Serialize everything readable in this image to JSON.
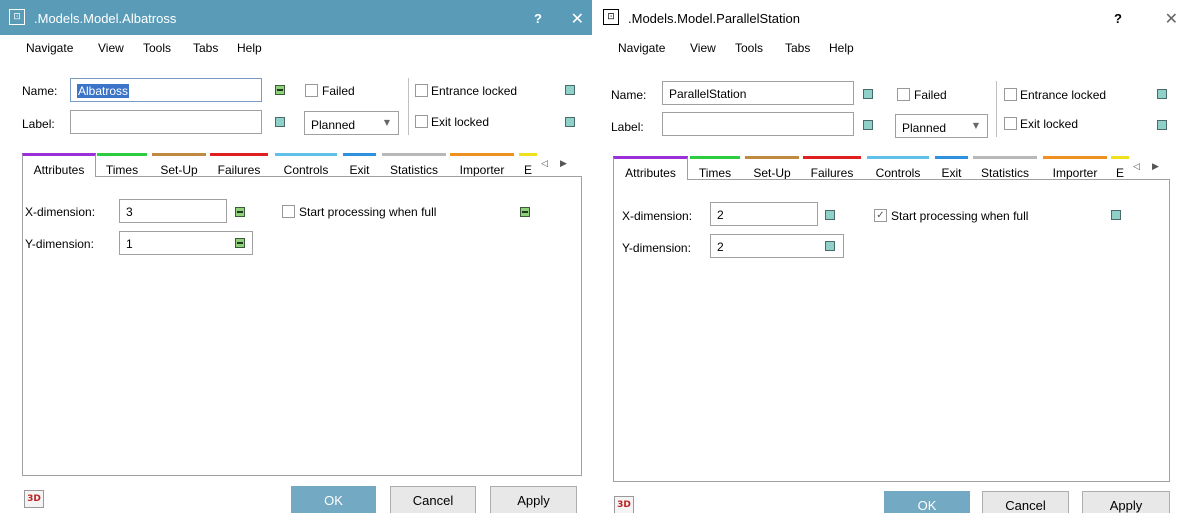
{
  "dialogs": [
    {
      "title": ".Models.Model.Albatross",
      "help": "?",
      "close": "✕",
      "menu": [
        "Navigate",
        "View",
        "Tools",
        "Tabs",
        "Help"
      ],
      "name_label": "Name:",
      "name_value": "Albatross",
      "label_label": "Label:",
      "label_value": "",
      "failed_label": "Failed",
      "failed_checked": false,
      "status_value": "Planned",
      "entrance_locked_label": "Entrance locked",
      "exit_locked_label": "Exit locked",
      "tabs": [
        "Attributes",
        "Times",
        "Set-Up",
        "Failures",
        "Controls",
        "Exit",
        "Statistics",
        "Importer",
        "E"
      ],
      "active_tab": "Attributes",
      "x_dim_label": "X-dimension:",
      "x_dim_value": "3",
      "y_dim_label": "Y-dimension:",
      "y_dim_value": "1",
      "start_processing_label": "Start processing when full",
      "start_processing_checked": false,
      "ok_label": "OK",
      "cancel_label": "Cancel",
      "apply_label": "Apply",
      "btn3d_label": "3D"
    },
    {
      "title": ".Models.Model.ParallelStation",
      "help": "?",
      "close": "✕",
      "menu": [
        "Navigate",
        "View",
        "Tools",
        "Tabs",
        "Help"
      ],
      "name_label": "Name:",
      "name_value": "ParallelStation",
      "label_label": "Label:",
      "label_value": "",
      "failed_label": "Failed",
      "failed_checked": false,
      "status_value": "Planned",
      "entrance_locked_label": "Entrance locked",
      "exit_locked_label": "Exit locked",
      "tabs": [
        "Attributes",
        "Times",
        "Set-Up",
        "Failures",
        "Controls",
        "Exit",
        "Statistics",
        "Importer",
        "E"
      ],
      "active_tab": "Attributes",
      "x_dim_label": "X-dimension:",
      "x_dim_value": "2",
      "y_dim_label": "Y-dimension:",
      "y_dim_value": "2",
      "start_processing_label": "Start processing when full",
      "start_processing_checked": true,
      "ok_label": "OK",
      "cancel_label": "Cancel",
      "apply_label": "Apply",
      "btn3d_label": "3D"
    }
  ],
  "tab_colors": [
    "#9b30d9",
    "#2ecc40",
    "#c08a40",
    "#e02020",
    "#60c0e8",
    "#3090e0",
    "#b8b8b8",
    "#f09020",
    "#f0e020"
  ],
  "colors": {
    "titlebar_active": "#5a9cb8",
    "ok_button": "#73a9c2",
    "indicator_teal": "#8fd0c8",
    "indicator_green": "#8fd07a"
  },
  "icons": {
    "app": "object-dialog-icon",
    "close": "close-icon",
    "dropdown": "chevron-down-icon",
    "tab_prev": "tab-scroll-left-icon",
    "tab_next": "tab-scroll-right-icon"
  }
}
